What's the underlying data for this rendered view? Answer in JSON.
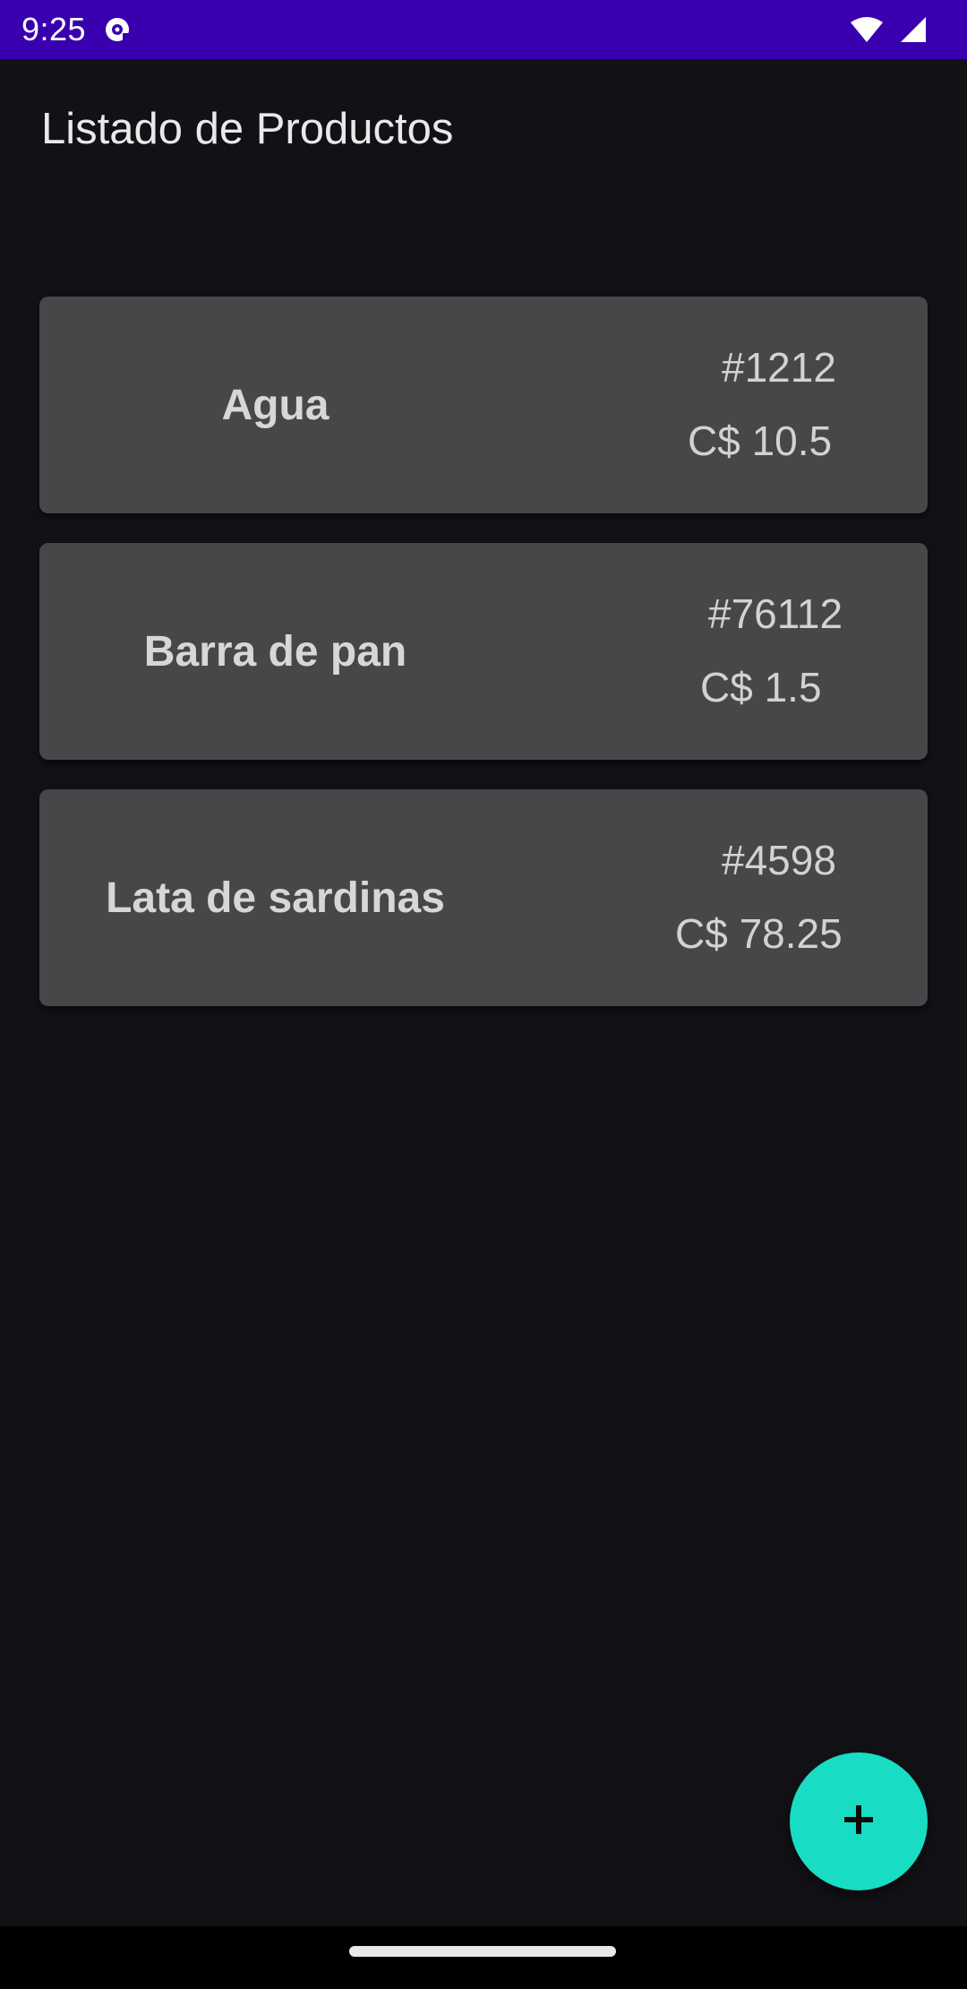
{
  "status_bar": {
    "time": "9:25",
    "icons": [
      "notification-icon",
      "wifi-icon",
      "signal-icon"
    ],
    "background_color": "#3a00b0"
  },
  "app_bar": {
    "title": "Listado de Productos"
  },
  "products": [
    {
      "name": "Agua",
      "code": "#1212",
      "price": "C$ 10.5"
    },
    {
      "name": "Barra de pan",
      "code": "#76112",
      "price": "C$ 1.5"
    },
    {
      "name": "Lata de sardinas",
      "code": "#4598",
      "price": "C$ 78.25"
    }
  ],
  "fab": {
    "icon": "plus-icon",
    "color": "#19dcc4"
  },
  "colors": {
    "background": "#121116",
    "card": "#47474a",
    "accent": "#19dcc4"
  }
}
